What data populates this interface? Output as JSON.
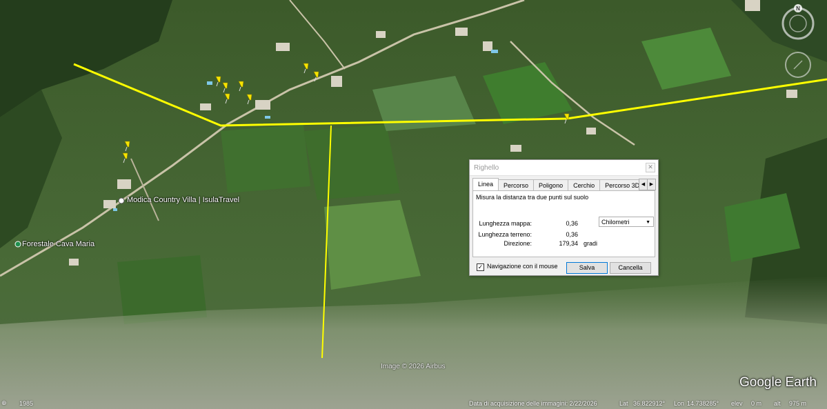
{
  "map": {
    "labels": {
      "villa": "Modica Country Villa | IsulaTravel",
      "forestale": "Forestale Cava Maria"
    },
    "attribution": "Image © 2026 Airbus",
    "logo": "Google Earth",
    "compass_north": "N",
    "colors": {
      "path": "#ffff00",
      "pin": "#f5e400"
    }
  },
  "ruler": {
    "title": "Righello",
    "close_icon": "close-icon",
    "tabs": [
      "Linea",
      "Percorso",
      "Poligono",
      "Cerchio",
      "Percorso 3D"
    ],
    "active_tab": "Linea",
    "description": "Misura la distanza tra due punti sul suolo",
    "map_length_label": "Lunghezza mappa:",
    "map_length_value": "0,36",
    "unit_selected": "Chilometri",
    "ground_length_label": "Lunghezza terreno:",
    "ground_length_value": "0,36",
    "heading_label": "Direzione:",
    "heading_value": "179,34",
    "heading_unit": "gradi",
    "mouse_nav_label": "Navigazione con il mouse",
    "mouse_nav_checked": true,
    "save_label": "Salva",
    "cancel_label": "Cancella"
  },
  "status": {
    "year": "1985",
    "acquisition": "Data di acquisizione delle immagini: 2/22/2026",
    "lat_label": "Lat",
    "lat_value": "36.822912°",
    "lon_label": "Lon",
    "lon_value": "14.738285°",
    "elev_label": "elev",
    "elev_value": "0 m",
    "alt_label": "alt",
    "alt_value": "975 m"
  }
}
